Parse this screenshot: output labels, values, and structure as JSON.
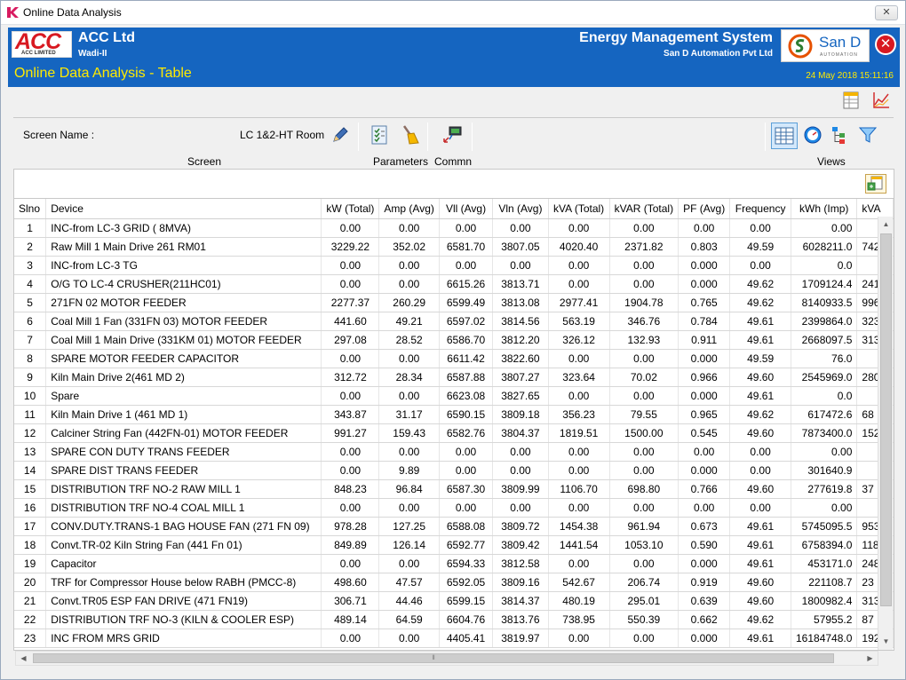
{
  "window": {
    "title": "Online Data Analysis",
    "close_glyph": "✕"
  },
  "header": {
    "company": "ACC Ltd",
    "site": "Wadi-II",
    "acc_logo_big": "ACC",
    "acc_logo_small": "ACC LIMITED",
    "system": "Energy Management System",
    "vendor": "San D Automation Pvt Ltd",
    "sand_logo_text": "San D",
    "sand_logo_sub": "AUTOMATION",
    "page_title": "Online Data Analysis - Table",
    "datetime": "24 May 2018 15:11:16",
    "exit_glyph": "✕"
  },
  "panel": {
    "screen_name_label": "Screen Name :",
    "screen_name_value": "LC 1&2-HT Room",
    "group_screen": "Screen",
    "group_parameters": "Parameters",
    "group_commn": "Commn",
    "group_views": "Views"
  },
  "table": {
    "columns": [
      "Slno",
      "Device",
      "kW (Total)",
      "Amp (Avg)",
      "Vll (Avg)",
      "Vln (Avg)",
      "kVA (Total)",
      "kVAR (Total)",
      "PF (Avg)",
      "Frequency",
      "kWh (Imp)",
      "kVA"
    ],
    "rows": [
      [
        "1",
        "INC-from LC-3 GRID ( 8MVA)",
        "0.00",
        "0.00",
        "0.00",
        "0.00",
        "0.00",
        "0.00",
        "0.00",
        "0.00",
        "0.00",
        ""
      ],
      [
        "2",
        "Raw Mill 1 Main Drive 261 RM01",
        "3229.22",
        "352.02",
        "6581.70",
        "3807.05",
        "4020.40",
        "2371.82",
        "0.803",
        "49.59",
        "6028211.0",
        "742"
      ],
      [
        "3",
        "INC-from LC-3 TG",
        "0.00",
        "0.00",
        "0.00",
        "0.00",
        "0.00",
        "0.00",
        "0.000",
        "0.00",
        "0.0",
        ""
      ],
      [
        "4",
        "O/G TO LC-4 CRUSHER(211HC01)",
        "0.00",
        "0.00",
        "6615.26",
        "3813.71",
        "0.00",
        "0.00",
        "0.000",
        "49.62",
        "1709124.4",
        "241"
      ],
      [
        "5",
        "271FN 02 MOTOR FEEDER",
        "2277.37",
        "260.29",
        "6599.49",
        "3813.08",
        "2977.41",
        "1904.78",
        "0.765",
        "49.62",
        "8140933.5",
        "996"
      ],
      [
        "6",
        "Coal Mill 1 Fan (331FN 03) MOTOR FEEDER",
        "441.60",
        "49.21",
        "6597.02",
        "3814.56",
        "563.19",
        "346.76",
        "0.784",
        "49.61",
        "2399864.0",
        "323"
      ],
      [
        "7",
        "Coal Mill 1 Main Drive (331KM 01) MOTOR FEEDER",
        "297.08",
        "28.52",
        "6586.70",
        "3812.20",
        "326.12",
        "132.93",
        "0.911",
        "49.61",
        "2668097.5",
        "313"
      ],
      [
        "8",
        "SPARE MOTOR FEEDER CAPACITOR",
        "0.00",
        "0.00",
        "6611.42",
        "3822.60",
        "0.00",
        "0.00",
        "0.000",
        "49.59",
        "76.0",
        ""
      ],
      [
        "9",
        "Kiln Main Drive 2(461 MD 2)",
        "312.72",
        "28.34",
        "6587.88",
        "3807.27",
        "323.64",
        "70.02",
        "0.966",
        "49.60",
        "2545969.0",
        "280"
      ],
      [
        "10",
        "Spare",
        "0.00",
        "0.00",
        "6623.08",
        "3827.65",
        "0.00",
        "0.00",
        "0.000",
        "49.61",
        "0.0",
        ""
      ],
      [
        "11",
        "Kiln Main Drive 1 (461 MD 1)",
        "343.87",
        "31.17",
        "6590.15",
        "3809.18",
        "356.23",
        "79.55",
        "0.965",
        "49.62",
        "617472.6",
        "68"
      ],
      [
        "12",
        "Calciner String Fan (442FN-01) MOTOR FEEDER",
        "991.27",
        "159.43",
        "6582.76",
        "3804.37",
        "1819.51",
        "1500.00",
        "0.545",
        "49.60",
        "7873400.0",
        "152"
      ],
      [
        "13",
        "SPARE CON DUTY TRANS FEEDER",
        "0.00",
        "0.00",
        "0.00",
        "0.00",
        "0.00",
        "0.00",
        "0.00",
        "0.00",
        "0.00",
        ""
      ],
      [
        "14",
        "SPARE DIST TRANS FEEDER",
        "0.00",
        "9.89",
        "0.00",
        "0.00",
        "0.00",
        "0.00",
        "0.000",
        "0.00",
        "301640.9",
        ""
      ],
      [
        "15",
        "DISTRIBUTION TRF NO-2 RAW MILL 1",
        "848.23",
        "96.84",
        "6587.30",
        "3809.99",
        "1106.70",
        "698.80",
        "0.766",
        "49.60",
        "277619.8",
        "37"
      ],
      [
        "16",
        "DISTRIBUTION TRF NO-4 COAL MILL 1",
        "0.00",
        "0.00",
        "0.00",
        "0.00",
        "0.00",
        "0.00",
        "0.00",
        "0.00",
        "0.00",
        ""
      ],
      [
        "17",
        "CONV.DUTY.TRANS-1 BAG HOUSE FAN (271 FN 09)",
        "978.28",
        "127.25",
        "6588.08",
        "3809.72",
        "1454.38",
        "961.94",
        "0.673",
        "49.61",
        "5745095.5",
        "953"
      ],
      [
        "18",
        "Convt.TR-02  Kiln String Fan (441 Fn 01)",
        "849.89",
        "126.14",
        "6592.77",
        "3809.42",
        "1441.54",
        "1053.10",
        "0.590",
        "49.61",
        "6758394.0",
        "118"
      ],
      [
        "19",
        "Capacitor",
        "0.00",
        "0.00",
        "6594.33",
        "3812.58",
        "0.00",
        "0.00",
        "0.000",
        "49.61",
        "453171.0",
        "248"
      ],
      [
        "20",
        "TRF for Compressor House below RABH (PMCC-8)",
        "498.60",
        "47.57",
        "6592.05",
        "3809.16",
        "542.67",
        "206.74",
        "0.919",
        "49.60",
        "221108.7",
        "23"
      ],
      [
        "21",
        "Convt.TR05 ESP FAN DRIVE (471 FN19)",
        "306.71",
        "44.46",
        "6599.15",
        "3814.37",
        "480.19",
        "295.01",
        "0.639",
        "49.60",
        "1800982.4",
        "313"
      ],
      [
        "22",
        "DISTRIBUTION TRF NO-3 (KILN & COOLER ESP)",
        "489.14",
        "64.59",
        "6604.76",
        "3813.76",
        "738.95",
        "550.39",
        "0.662",
        "49.62",
        "57955.2",
        "87"
      ],
      [
        "23",
        "INC FROM MRS GRID",
        "0.00",
        "0.00",
        "4405.41",
        "3819.97",
        "0.00",
        "0.00",
        "0.000",
        "49.61",
        "16184748.0",
        "192"
      ]
    ]
  },
  "colors": {
    "banner": "#1565c0",
    "accent_yellow": "#ffea00",
    "acc_red": "#d81921"
  },
  "icons": [
    "k-app-icon",
    "table-report-icon",
    "trend-chart-icon",
    "edit-pencil-icon",
    "checklist-icon",
    "broom-icon",
    "network-icon",
    "table-view-icon",
    "gauge-view-icon",
    "tree-view-icon",
    "filter-icon",
    "export-icon"
  ]
}
